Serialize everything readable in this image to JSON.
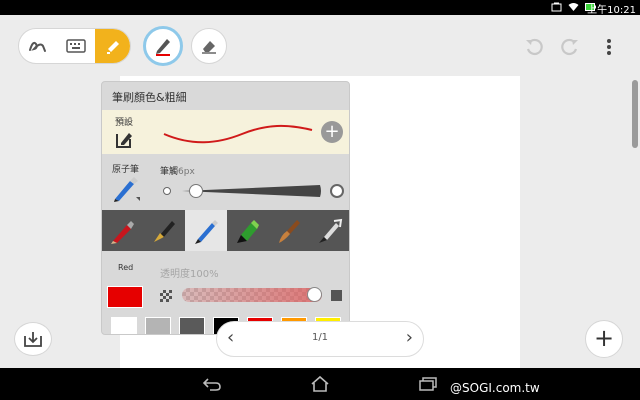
{
  "status_bar": {
    "time": "上午10:21"
  },
  "toolbar": {
    "tools": [
      "handwriting",
      "keyboard",
      "highlighter"
    ],
    "active_tool": "highlighter",
    "pen_active": true
  },
  "panel": {
    "title": "筆刷顏色&粗細",
    "preset_label": "預設",
    "preset_add": "+",
    "pen_name": "原子筆",
    "size_label": "筆觸",
    "size_value": "6px",
    "size_level": 0.05,
    "color_name": "Red",
    "opacity_label": "透明度100%",
    "opacity_level": 1.0,
    "pen_types": [
      "red-pencil",
      "fountain-pen",
      "ballpoint-pen",
      "marker",
      "brush",
      "calligraphy-pen"
    ],
    "selected_pen_type": "ballpoint-pen",
    "current_color": "#e60000",
    "palette": [
      "#ffffff",
      "#b4b4b4",
      "#5a5a5a",
      "#000000",
      "#e60000",
      "#ff9900",
      "#ffee00"
    ]
  },
  "pager": {
    "prev": "‹",
    "count": "1/1",
    "next": "›"
  },
  "add_page": "+",
  "watermark": "@SOGI.com.tw"
}
